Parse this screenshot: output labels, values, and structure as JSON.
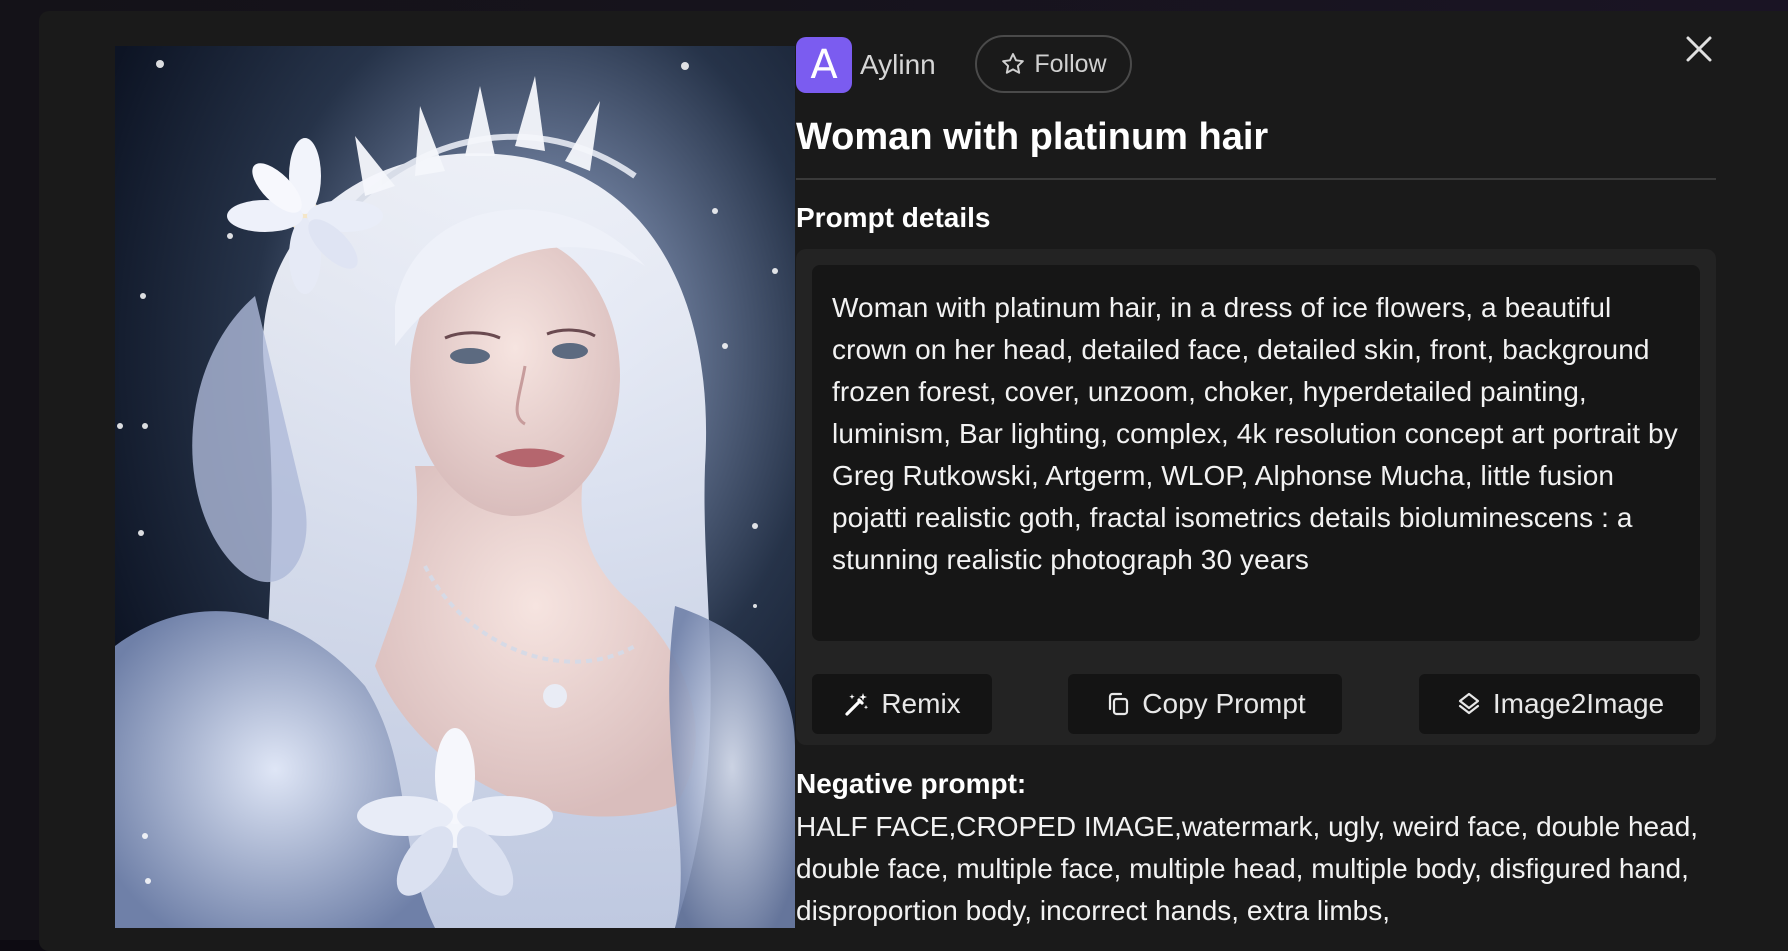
{
  "author": {
    "avatar_letter": "A",
    "name": "Aylinn",
    "avatar_color": "#7b5cf0"
  },
  "follow_button": {
    "label": "Follow",
    "icon": "star-outline-icon"
  },
  "close_button": {
    "icon": "close-icon"
  },
  "title": "Woman with platinum hair",
  "prompt_section": {
    "label": "Prompt details",
    "text": "Woman with platinum hair, in a dress of ice flowers, a beautiful crown on her head, detailed face, detailed skin, front, background frozen forest, cover, unzoom, choker, hyperdetailed painting, luminism, Bar lighting, complex, 4k resolution concept art portrait by Greg Rutkowski, Artgerm, WLOP, Alphonse Mucha, little fusion pojatti realistic goth, fractal isometrics details bioluminescens : a stunning realistic photograph 30 years"
  },
  "actions": {
    "remix": {
      "label": "Remix",
      "icon": "magic-wand-icon"
    },
    "copy": {
      "label": "Copy Prompt",
      "icon": "copy-icon"
    },
    "image2image": {
      "label": "Image2Image",
      "icon": "layers-icon"
    }
  },
  "negative_section": {
    "label": "Negative prompt:",
    "text": "HALF FACE,CROPED IMAGE,watermark, ugly, weird face, double head, double face, multiple face, multiple head, multiple body, disfigured hand, disproportion body, incorrect hands, extra limbs,"
  },
  "colors": {
    "modal_bg": "#1a1a1a",
    "card_bg": "#232323",
    "text_box_bg": "#161616",
    "accent": "#7b5cf0"
  }
}
